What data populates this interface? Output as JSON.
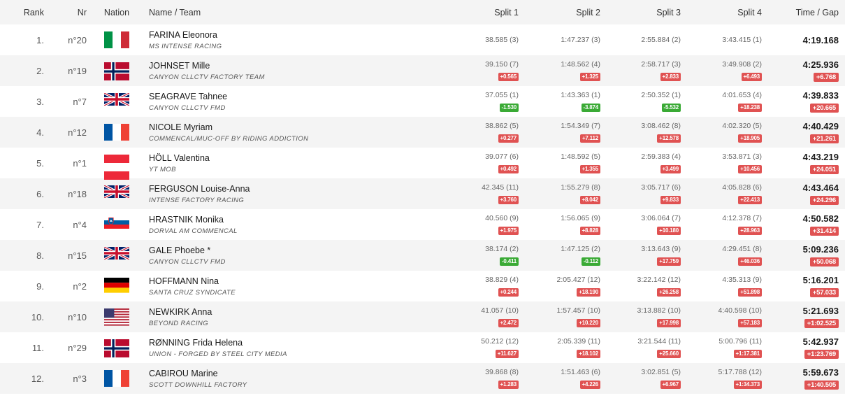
{
  "headers": {
    "rank": "Rank",
    "nr": "Nr",
    "nation": "Nation",
    "name_team": "Name / Team",
    "split1": "Split 1",
    "split2": "Split 2",
    "split3": "Split 3",
    "split4": "Split 4",
    "time_gap": "Time / Gap"
  },
  "colors": {
    "gap_positive": "#e05252",
    "gap_negative": "#3aaa35",
    "row_alt": "#f4f4f4"
  },
  "rows": [
    {
      "rank": "1.",
      "nr": "n°20",
      "nation": "italy-flag",
      "name": "FARINA Eleonora",
      "team": "MS INTENSE RACING",
      "splits": [
        {
          "t": "38.585 (3)",
          "gap": ""
        },
        {
          "t": "1:47.237 (3)",
          "gap": ""
        },
        {
          "t": "2:55.884 (2)",
          "gap": ""
        },
        {
          "t": "3:43.415 (1)",
          "gap": ""
        }
      ],
      "time": "4:19.168",
      "gap": ""
    },
    {
      "rank": "2.",
      "nr": "n°19",
      "nation": "norway-flag",
      "name": "JOHNSET Mille",
      "team": "CANYON CLLCTV FACTORY TEAM",
      "splits": [
        {
          "t": "39.150 (7)",
          "gap": "+0.565"
        },
        {
          "t": "1:48.562 (4)",
          "gap": "+1.325"
        },
        {
          "t": "2:58.717 (3)",
          "gap": "+2.833"
        },
        {
          "t": "3:49.908 (2)",
          "gap": "+6.493"
        }
      ],
      "time": "4:25.936",
      "gap": "+6.768"
    },
    {
      "rank": "3.",
      "nr": "n°7",
      "nation": "uk-flag",
      "name": "SEAGRAVE Tahnee",
      "team": "CANYON CLLCTV FMD",
      "splits": [
        {
          "t": "37.055 (1)",
          "gap": "-1.530"
        },
        {
          "t": "1:43.363 (1)",
          "gap": "-3.874"
        },
        {
          "t": "2:50.352 (1)",
          "gap": "-5.532"
        },
        {
          "t": "4:01.653 (4)",
          "gap": "+18.238"
        }
      ],
      "time": "4:39.833",
      "gap": "+20.665"
    },
    {
      "rank": "4.",
      "nr": "n°12",
      "nation": "france-flag",
      "name": "NICOLE Myriam",
      "team": "COMMENCAL/MUC-OFF BY RIDING ADDICTION",
      "splits": [
        {
          "t": "38.862 (5)",
          "gap": "+0.277"
        },
        {
          "t": "1:54.349 (7)",
          "gap": "+7.112"
        },
        {
          "t": "3:08.462 (8)",
          "gap": "+12.578"
        },
        {
          "t": "4:02.320 (5)",
          "gap": "+18.905"
        }
      ],
      "time": "4:40.429",
      "gap": "+21.261"
    },
    {
      "rank": "5.",
      "nr": "n°1",
      "nation": "austria-flag",
      "name": "HÖLL Valentina",
      "team": "YT MOB",
      "splits": [
        {
          "t": "39.077 (6)",
          "gap": "+0.492"
        },
        {
          "t": "1:48.592 (5)",
          "gap": "+1.355"
        },
        {
          "t": "2:59.383 (4)",
          "gap": "+3.499"
        },
        {
          "t": "3:53.871 (3)",
          "gap": "+10.456"
        }
      ],
      "time": "4:43.219",
      "gap": "+24.051"
    },
    {
      "rank": "6.",
      "nr": "n°18",
      "nation": "uk-flag",
      "name": "FERGUSON Louise-Anna",
      "team": "INTENSE FACTORY RACING",
      "splits": [
        {
          "t": "42.345 (11)",
          "gap": "+3.760"
        },
        {
          "t": "1:55.279 (8)",
          "gap": "+8.042"
        },
        {
          "t": "3:05.717 (6)",
          "gap": "+9.833"
        },
        {
          "t": "4:05.828 (6)",
          "gap": "+22.413"
        }
      ],
      "time": "4:43.464",
      "gap": "+24.296"
    },
    {
      "rank": "7.",
      "nr": "n°4",
      "nation": "slovenia-flag",
      "name": "HRASTNIK Monika",
      "team": "DORVAL AM COMMENCAL",
      "splits": [
        {
          "t": "40.560 (9)",
          "gap": "+1.975"
        },
        {
          "t": "1:56.065 (9)",
          "gap": "+8.828"
        },
        {
          "t": "3:06.064 (7)",
          "gap": "+10.180"
        },
        {
          "t": "4:12.378 (7)",
          "gap": "+28.963"
        }
      ],
      "time": "4:50.582",
      "gap": "+31.414"
    },
    {
      "rank": "8.",
      "nr": "n°15",
      "nation": "uk-flag",
      "name": "GALE Phoebe *",
      "team": "CANYON CLLCTV FMD",
      "splits": [
        {
          "t": "38.174 (2)",
          "gap": "-0.411"
        },
        {
          "t": "1:47.125 (2)",
          "gap": "-0.112"
        },
        {
          "t": "3:13.643 (9)",
          "gap": "+17.759"
        },
        {
          "t": "4:29.451 (8)",
          "gap": "+46.036"
        }
      ],
      "time": "5:09.236",
      "gap": "+50.068"
    },
    {
      "rank": "9.",
      "nr": "n°2",
      "nation": "germany-flag",
      "name": "HOFFMANN Nina",
      "team": "SANTA CRUZ SYNDICATE",
      "splits": [
        {
          "t": "38.829 (4)",
          "gap": "+0.244"
        },
        {
          "t": "2:05.427 (12)",
          "gap": "+18.190"
        },
        {
          "t": "3:22.142 (12)",
          "gap": "+26.258"
        },
        {
          "t": "4:35.313 (9)",
          "gap": "+51.898"
        }
      ],
      "time": "5:16.201",
      "gap": "+57.033"
    },
    {
      "rank": "10.",
      "nr": "n°10",
      "nation": "usa-flag",
      "name": "NEWKIRK Anna",
      "team": "BEYOND RACING",
      "splits": [
        {
          "t": "41.057 (10)",
          "gap": "+2.472"
        },
        {
          "t": "1:57.457 (10)",
          "gap": "+10.220"
        },
        {
          "t": "3:13.882 (10)",
          "gap": "+17.998"
        },
        {
          "t": "4:40.598 (10)",
          "gap": "+57.183"
        }
      ],
      "time": "5:21.693",
      "gap": "+1:02.525"
    },
    {
      "rank": "11.",
      "nr": "n°29",
      "nation": "norway-flag",
      "name": "RØNNING Frida Helena",
      "team": "UNION - FORGED BY STEEL CITY MEDIA",
      "splits": [
        {
          "t": "50.212 (12)",
          "gap": "+11.627"
        },
        {
          "t": "2:05.339 (11)",
          "gap": "+18.102"
        },
        {
          "t": "3:21.544 (11)",
          "gap": "+25.660"
        },
        {
          "t": "5:00.796 (11)",
          "gap": "+1:17.381"
        }
      ],
      "time": "5:42.937",
      "gap": "+1:23.769"
    },
    {
      "rank": "12.",
      "nr": "n°3",
      "nation": "france-flag",
      "name": "CABIROU Marine",
      "team": "SCOTT DOWNHILL FACTORY",
      "splits": [
        {
          "t": "39.868 (8)",
          "gap": "+1.283"
        },
        {
          "t": "1:51.463 (6)",
          "gap": "+4.226"
        },
        {
          "t": "3:02.851 (5)",
          "gap": "+6.967"
        },
        {
          "t": "5:17.788 (12)",
          "gap": "+1:34.373"
        }
      ],
      "time": "5:59.673",
      "gap": "+1:40.505"
    }
  ]
}
